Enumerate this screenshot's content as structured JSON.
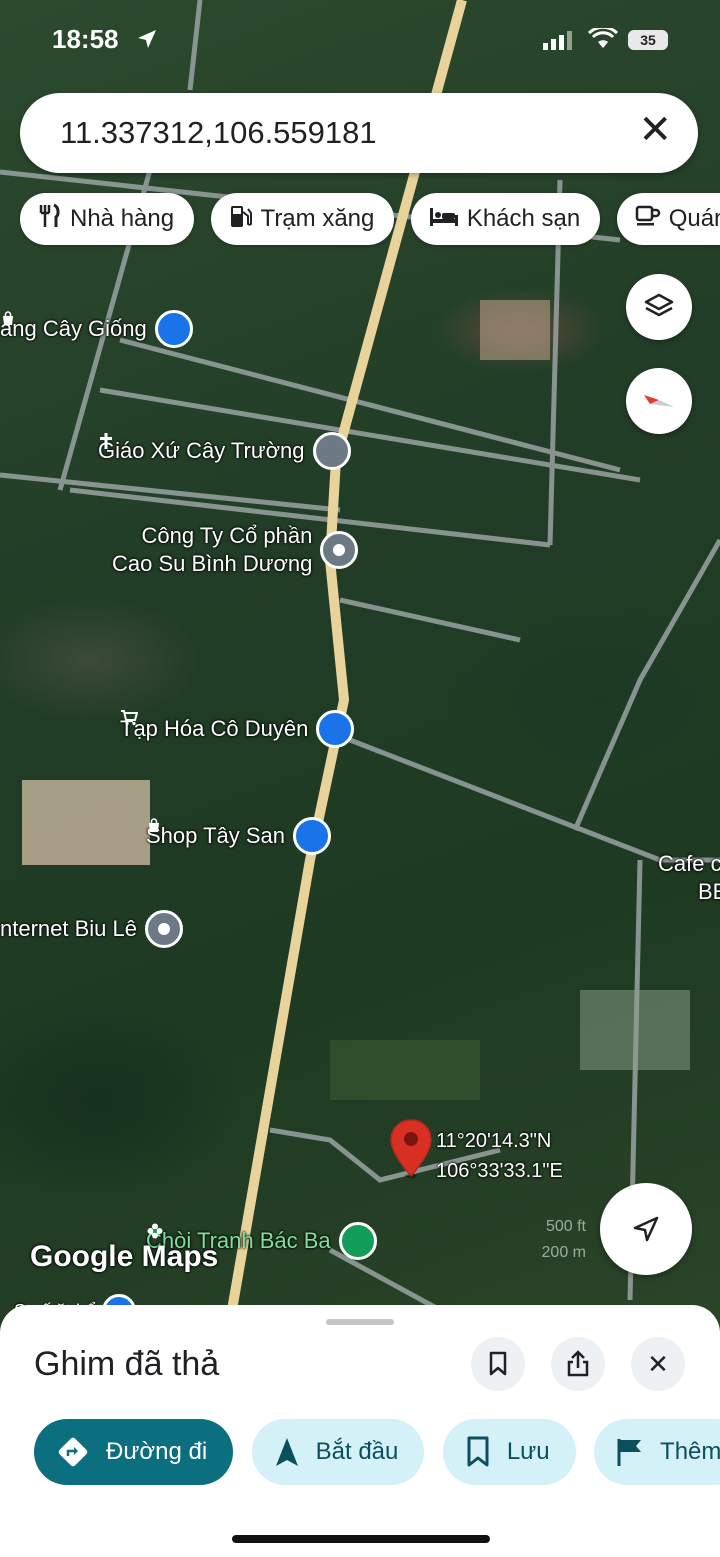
{
  "status_bar": {
    "time": "18:58",
    "battery": "35"
  },
  "search": {
    "query": "11.337312,106.559181"
  },
  "chips": [
    {
      "label": "Nhà hàng",
      "icon": "restaurant-icon"
    },
    {
      "label": "Trạm xăng",
      "icon": "gas-station-icon"
    },
    {
      "label": "Khách sạn",
      "icon": "hotel-icon"
    },
    {
      "label": "Quán",
      "icon": "cafe-icon"
    }
  ],
  "pois": {
    "cay_giong": "àng Cây Giống",
    "giao_xu": "Giáo Xứ Cây Trường",
    "cong_ty_line1": "Công Ty Cổ phần",
    "cong_ty_line2": "Cao Su Bình Dương",
    "tap_hoa": "Tạp Hóa Cô Duyên",
    "shop": "Shop Tây San",
    "internet": "nternet Biu Lê",
    "cafe_line1": "Cafe c",
    "cafe_line2": "BE",
    "choi_tranh": "Chòi Tranh Bác Ba",
    "partial_bottom": "Sa    ấ     ặt hổ"
  },
  "dropped_pin": {
    "lat": "11°20'14.3\"N",
    "lng": "106°33'33.1\"E"
  },
  "scale": {
    "top": "500 ft",
    "bottom": "200 m"
  },
  "watermark": "Google Maps",
  "sheet": {
    "title": "Ghim đã thả",
    "actions": {
      "directions": "Đường đi",
      "start": "Bắt đầu",
      "save": "Lưu",
      "more": "Thêm"
    }
  },
  "colors": {
    "primary": "#0b6f7f",
    "secondary_bg": "#d4f1f7",
    "road": "#e8d49a",
    "pin": "#d93025"
  }
}
